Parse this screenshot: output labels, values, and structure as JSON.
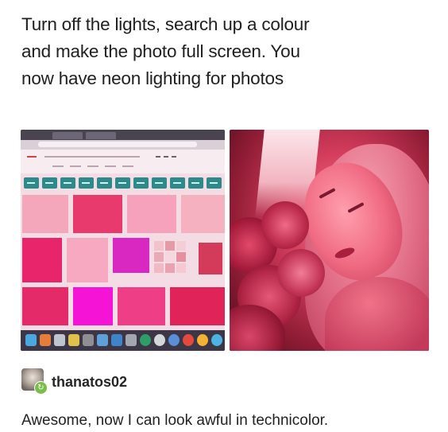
{
  "caption": {
    "lines": [
      "Turn off the lights, search up a colour",
      "and make the photo full screen. You",
      "now have neon lighting for photos"
    ]
  },
  "photos": {
    "left": {
      "subject": "laptop screen showing pink colour search results"
    },
    "right": {
      "subject": "woman lit by pink neon light with roses"
    }
  },
  "comment": {
    "username": "thanatos02",
    "text": "Awesome, now I can look awful in technicolor.",
    "avatar_icon": "avatar-icon",
    "badge_icon": "reblog-badge-icon"
  },
  "colors": {
    "text": "#202020",
    "badge": "#7bbd4a",
    "screen_pink": "#f3dce3",
    "chip_teal": "#2b8a8a"
  }
}
